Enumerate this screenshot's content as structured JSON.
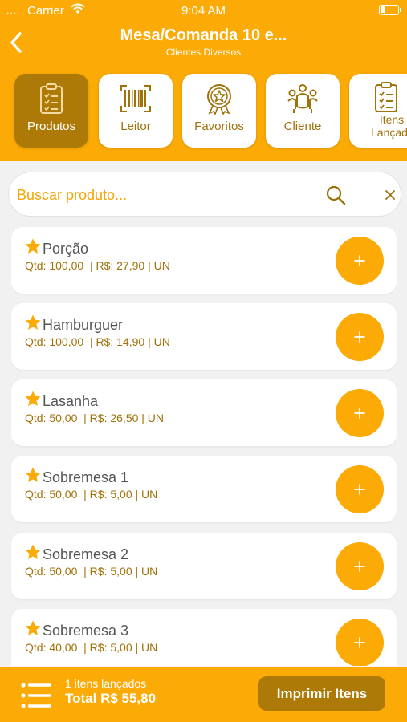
{
  "status_bar": {
    "dots": "....",
    "carrier": "Carrier",
    "time": "9:04 AM"
  },
  "header": {
    "title": "Mesa/Comanda 10 e...",
    "subtitle": "Clientes Diversos"
  },
  "tabs": [
    {
      "label": "Produtos",
      "icon": "clipboard-icon",
      "active": true
    },
    {
      "label": "Leitor",
      "icon": "barcode-icon",
      "active": false
    },
    {
      "label": "Favoritos",
      "icon": "award-star-icon",
      "active": false
    },
    {
      "label": "Cliente",
      "icon": "people-table-icon",
      "active": false
    },
    {
      "label": "Itens Lançados",
      "icon": "clipboard-icon",
      "active": false
    }
  ],
  "search": {
    "placeholder": "Buscar produto..."
  },
  "products": [
    {
      "name": "Porção",
      "meta": "Qtd: 100,00  | R$: 27,90 | UN"
    },
    {
      "name": "Hamburguer",
      "meta": "Qtd: 100,00  | R$: 14,90 | UN"
    },
    {
      "name": "Lasanha",
      "meta": "Qtd: 50,00  | R$: 26,50 | UN"
    },
    {
      "name": "Sobremesa 1",
      "meta": "Qtd: 50,00  | R$: 5,00 | UN"
    },
    {
      "name": "Sobremesa 2",
      "meta": "Qtd: 50,00  | R$: 5,00 | UN"
    },
    {
      "name": "Sobremesa 3",
      "meta": "Qtd: 40,00  | R$: 5,00 | UN"
    }
  ],
  "footer": {
    "count_label": "1 itens lançados",
    "total_label": "Total R$ 55,80",
    "print_label": "Imprimir Itens"
  },
  "colors": {
    "accent": "#fbaa06",
    "dark_accent": "#ad7a07",
    "text_brown": "#a0720a"
  }
}
